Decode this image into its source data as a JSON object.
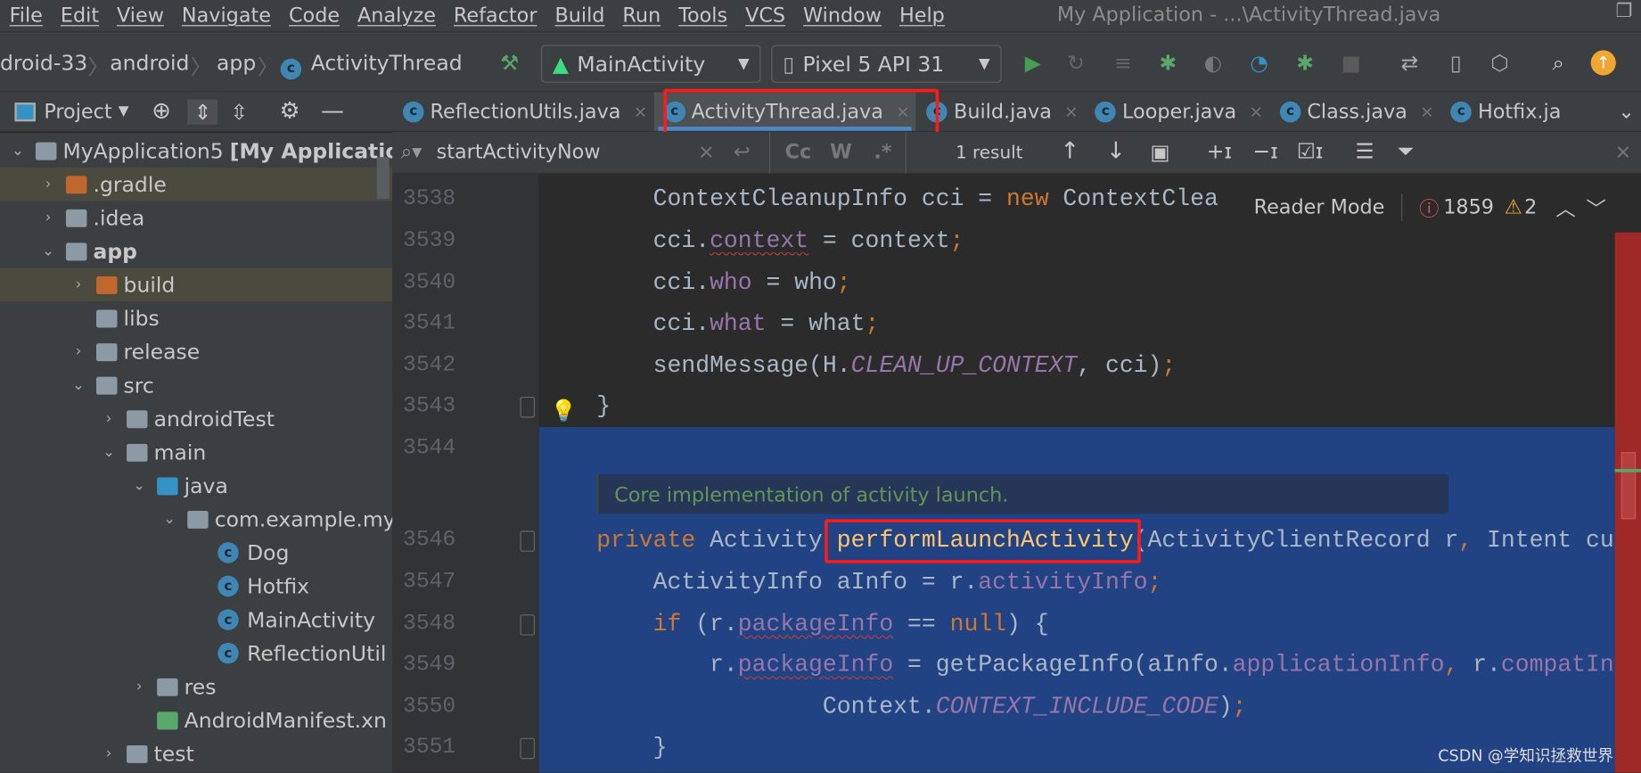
{
  "menu": [
    "File",
    "Edit",
    "View",
    "Navigate",
    "Code",
    "Analyze",
    "Refactor",
    "Build",
    "Run",
    "Tools",
    "VCS",
    "Window",
    "Help"
  ],
  "window_title": "My Application - ...\\ActivityThread.java",
  "breadcrumb": [
    "droid-33",
    "android",
    "app",
    "ActivityThread"
  ],
  "run_config": "MainActivity",
  "device": "Pixel 5 API 31",
  "project_panel": {
    "title": "Project"
  },
  "tabs": [
    {
      "label": "ReflectionUtils.java"
    },
    {
      "label": "ActivityThread.java",
      "active": true
    },
    {
      "label": "Build.java"
    },
    {
      "label": "Looper.java"
    },
    {
      "label": "Class.java"
    },
    {
      "label": "Hotfix.ja"
    }
  ],
  "tree": [
    {
      "label": "MyApplication5",
      "bold_suffix": "[My Applicatio",
      "indent": 0,
      "arrow": "down",
      "icon": "module"
    },
    {
      "label": ".gradle",
      "indent": 1,
      "arrow": "right",
      "icon": "folder-orange",
      "selected": true
    },
    {
      "label": ".idea",
      "indent": 1,
      "arrow": "right",
      "icon": "folder"
    },
    {
      "label": "app",
      "indent": 1,
      "arrow": "down",
      "icon": "module",
      "bold": true
    },
    {
      "label": "build",
      "indent": 2,
      "arrow": "right",
      "icon": "folder-orange",
      "selected": true
    },
    {
      "label": "libs",
      "indent": 2,
      "arrow": "",
      "icon": "folder"
    },
    {
      "label": "release",
      "indent": 2,
      "arrow": "right",
      "icon": "folder"
    },
    {
      "label": "src",
      "indent": 2,
      "arrow": "down",
      "icon": "folder"
    },
    {
      "label": "androidTest",
      "indent": 3,
      "arrow": "right",
      "icon": "folder"
    },
    {
      "label": "main",
      "indent": 3,
      "arrow": "down",
      "icon": "folder"
    },
    {
      "label": "java",
      "indent": 4,
      "arrow": "down",
      "icon": "folder-blue"
    },
    {
      "label": "com.example.my",
      "indent": 5,
      "arrow": "down",
      "icon": "package"
    },
    {
      "label": "Dog",
      "indent": 6,
      "arrow": "",
      "icon": "class"
    },
    {
      "label": "Hotfix",
      "indent": 6,
      "arrow": "",
      "icon": "class"
    },
    {
      "label": "MainActivity",
      "indent": 6,
      "arrow": "",
      "icon": "class"
    },
    {
      "label": "ReflectionUtil",
      "indent": 6,
      "arrow": "",
      "icon": "class"
    },
    {
      "label": "res",
      "indent": 4,
      "arrow": "right",
      "icon": "res"
    },
    {
      "label": "AndroidManifest.xn",
      "indent": 4,
      "arrow": "",
      "icon": "manifest"
    },
    {
      "label": "test",
      "indent": 3,
      "arrow": "right",
      "icon": "folder"
    }
  ],
  "search": {
    "query": "startActivityNow",
    "result": "1 result",
    "opt_case": "Cc",
    "opt_word": "W",
    "opt_regex": ".*"
  },
  "reader_mode": {
    "label": "Reader Mode",
    "errors": "1859",
    "warnings": "2"
  },
  "doc_comment": "Core implementation of activity launch.",
  "code": [
    {
      "n": "3538",
      "t": [
        [
          "    ContextCleanupInfo cci = ",
          ""
        ],
        [
          "new",
          "kw"
        ],
        [
          " ContextClea",
          ""
        ]
      ]
    },
    {
      "n": "3539",
      "t": [
        [
          "    cci.",
          ""
        ],
        [
          "context",
          "fld err"
        ],
        [
          " = context",
          ""
        ],
        [
          ";",
          "sm"
        ]
      ]
    },
    {
      "n": "3540",
      "t": [
        [
          "    cci.",
          ""
        ],
        [
          "who",
          "fld"
        ],
        [
          " = who",
          ""
        ],
        [
          ";",
          "sm"
        ]
      ]
    },
    {
      "n": "3541",
      "t": [
        [
          "    cci.",
          ""
        ],
        [
          "what",
          "fld"
        ],
        [
          " = what",
          ""
        ],
        [
          ";",
          "sm"
        ]
      ]
    },
    {
      "n": "3542",
      "t": [
        [
          "    sendMessage(H.",
          ""
        ],
        [
          "CLEAN_UP_CONTEXT",
          "st"
        ],
        [
          ", cci)",
          ""
        ],
        [
          ";",
          "sm"
        ]
      ]
    },
    {
      "n": "3543",
      "t": [
        [
          "}",
          ""
        ]
      ]
    },
    {
      "n": "3544",
      "t": []
    },
    {
      "n": "3546",
      "t": [
        [
          "private",
          "kw"
        ],
        [
          " Activity ",
          ""
        ],
        [
          "performLaunchActivity",
          "fn"
        ],
        [
          "(ActivityClientRecord r",
          ""
        ],
        [
          ",",
          "sm"
        ],
        [
          " Intent cu",
          ""
        ]
      ]
    },
    {
      "n": "3547",
      "t": [
        [
          "    ActivityInfo aInfo = r.",
          ""
        ],
        [
          "activityInfo",
          "fld"
        ],
        [
          ";",
          "sm"
        ]
      ]
    },
    {
      "n": "3548",
      "t": [
        [
          "    ",
          ""
        ],
        [
          "if",
          "kw"
        ],
        [
          " (r.",
          ""
        ],
        [
          "packageInfo",
          "fld err"
        ],
        [
          " == ",
          ""
        ],
        [
          "null",
          "kw"
        ],
        [
          ") {",
          ""
        ]
      ]
    },
    {
      "n": "3549",
      "t": [
        [
          "        r.",
          ""
        ],
        [
          "packageInfo",
          "fld err"
        ],
        [
          " = getPackageInfo(aInfo.",
          ""
        ],
        [
          "applicationInfo",
          "fld"
        ],
        [
          ",",
          "sm"
        ],
        [
          " r.",
          ""
        ],
        [
          "compatIn",
          "fld"
        ]
      ]
    },
    {
      "n": "3550",
      "t": [
        [
          "                Context.",
          ""
        ],
        [
          "CONTEXT_INCLUDE_CODE",
          "st"
        ],
        [
          ")",
          ""
        ],
        [
          ";",
          "sm"
        ]
      ]
    },
    {
      "n": "3551",
      "t": [
        [
          "    }",
          ""
        ]
      ]
    }
  ],
  "watermark": "CSDN @学知识拯救世界",
  "colors": {
    "accent": "#4a88c7",
    "highlight_box": "#ff1a1a",
    "selection": "#214283",
    "error_stripe": "#9e2927"
  }
}
